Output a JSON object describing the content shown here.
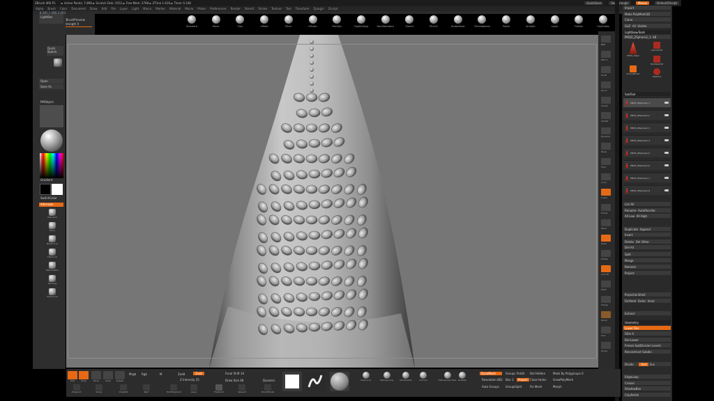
{
  "app": {
    "title": "ZBrush 4R6 P1",
    "stats": "► Active Points: 7.898 ► Scratch Disk: 2551 ► Free Mem: 2798 ► ZTime 1.616 ► Timer 0.148"
  },
  "topbar": {
    "quicksave": "QuickSave",
    "seethrough": "See-through",
    "menus": "Menus",
    "script": "DefaultZScript"
  },
  "menubar": {
    "items": [
      "Alpha",
      "Brush",
      "Color",
      "Document",
      "Draw",
      "Edit",
      "File",
      "Layer",
      "Light",
      "Macro",
      "Marker",
      "Material",
      "Movie",
      "Picker",
      "Preferences",
      "Render",
      "Stencil",
      "Stroke",
      "Texture",
      "Tool",
      "Transform",
      "Zplugin",
      "Zscript"
    ]
  },
  "strip": {
    "text": "8.381,1.490,2.403"
  },
  "topleft": {
    "projection": "Projection Master",
    "lightbox": "LightBox",
    "quicksketch": "Quick Sketch",
    "zbrush_preview": "ZBrushPreview",
    "strength": "Strength 0"
  },
  "brushshelf": [
    {
      "label": "Standard"
    },
    {
      "label": "Move"
    },
    {
      "label": "Clay"
    },
    {
      "label": "Inflate"
    },
    {
      "label": "Pinch"
    },
    {
      "label": "hPolish"
    },
    {
      "label": "TrimDyn"
    },
    {
      "label": "ClayBuildup"
    },
    {
      "label": "DamStandard"
    },
    {
      "label": "Slash3"
    },
    {
      "label": "Pinch2"
    },
    {
      "label": "SnakeHook"
    },
    {
      "label": "TrimAdaptive"
    },
    {
      "label": "Polish"
    },
    {
      "label": "Smooth"
    },
    {
      "label": "Layer"
    },
    {
      "label": "Flatten"
    },
    {
      "label": "ClayTubes"
    }
  ],
  "left": {
    "lightbox": "LightBox",
    "quick": "Quick Sketch",
    "open": "Open",
    "saveas": "Save As",
    "pmaterial": "PMObject",
    "gradient": "Gradient",
    "switchcolor": "SwitchColor",
    "alternate": "Alternate",
    "tools": [
      "Standard",
      "Move",
      "MaskCurve",
      "ClipCurve",
      "MatchMaker",
      "Topology",
      "SliceCurve"
    ]
  },
  "rshelf": {
    "labels": [
      "BPR",
      "SPix 3",
      "Scroll",
      "Zoom",
      "Actual",
      "AAHalf",
      "Dynamic",
      "Persp",
      "Floor",
      "Local",
      "L.Sym",
      "Frame",
      "Move",
      "Scale",
      "Rotate",
      "Line Fill",
      "PolyF",
      "Transp",
      "Ghost",
      "Solo",
      "Xpose"
    ]
  },
  "rpanel": {
    "load": "Load Tool",
    "saveas": "Save As",
    "import": "Import",
    "export": "Export",
    "clone": "Clone",
    "makepoly": "Make PolyMesh3D",
    "goz": "GoZ",
    "all": "All",
    "visible": "Visible",
    "r": "R",
    "lightbox_tools": "Lightbox▸Tools",
    "toolname": "PM3D_ZSphere2_1- 48",
    "tools": [
      {
        "label": "PM3D_ZSph"
      },
      {
        "label": "Cylinder3D"
      },
      {
        "label": "PolyMesh3D"
      },
      {
        "label": "SimpleBrush"
      },
      {
        "label": "ZSphere"
      }
    ],
    "subtool": "SubTool",
    "subtools": [
      "PM3D_ZSphere2_1",
      "PM3D_ZSphere2_2",
      "PM3D_ZSphere2_3",
      "PM3D_ZSphere2_4",
      "PM3D_ZSphere2_5",
      "PM3D_ZSphere2_6",
      "PM3D_ZSphere2_7",
      "PM3D_ZSphere2_8"
    ],
    "listall": "List All",
    "rename": "Rename",
    "autoreorder": "AutoReorder",
    "alllow": "All Low",
    "allhigh": "All High",
    "duplicate": "Duplicate",
    "append": "Append",
    "insert": "Insert",
    "delete": "Delete",
    "delother": "Del Other",
    "delall": "Del All",
    "split": "Split",
    "merge": "Merge",
    "remesh": "Remesh",
    "project": "Project",
    "projection_shell": "ProjectionShell",
    "farthest": "Farthest",
    "outer": "Outer",
    "inner": "Inner",
    "extract": "Extract",
    "geometry": "Geometry",
    "lowerres": "Lower Res",
    "higherres": "Higher Res",
    "sdiv": "SDiv 6",
    "dellower": "Del Lower",
    "delhigher": "Del Higher",
    "freeze": "Freeze SubDivision Levels",
    "reconstruct": "Reconstruct Subdiv",
    "divide": "Divide",
    "smt": "Smt",
    "suv": "Suv",
    "edgeloop": "EdgeLoop",
    "crease": "Crease",
    "shadowbox": "ShadowBox",
    "claypolish": "ClayPolish",
    "dynamesh": "DynaMesh"
  },
  "bottom": {
    "edit": "Edit",
    "draw": "Draw",
    "move": "Move",
    "scale": "Scale",
    "rotate": "Rotate",
    "mrgb": "Mrgb",
    "rgb": "Rgb",
    "m": "M",
    "zadd": "Zadd",
    "zsub": "Zsub",
    "zcut": "Zcut",
    "focal": "Focal Shift 34",
    "drawsize": "Draw Size 48",
    "dynamic": "Dynamic",
    "zintensity": "Z Intensity 25",
    "icons": [
      "Dragrect",
      "Spray",
      "DragDot",
      "Rect",
      "DotsFreehand",
      "Lasso",
      "Freehand",
      "Spacer3",
      "BrushStroke"
    ],
    "materials": [
      "ClayCurve",
      "MatCap Gray",
      "SkinShade4",
      "Chrome",
      "MatCap Red Wax",
      "RedWax"
    ],
    "dynamesh": "DynaMesh",
    "groups": "Groups",
    "polish": "Polish",
    "resolution": "Resolution 862",
    "blur": "Blur 2",
    "project": "Project",
    "autogroups": "Auto Groups",
    "groupsplit": "GroupsSplit",
    "delhidden": "Del Hidden",
    "closeholes": "Close Holes",
    "fixmesh": "Fix Mesh",
    "maskbypoly": "Mask By Polygroups 0",
    "growpoly": "GrowPolyMesh",
    "morph": "Morph"
  }
}
